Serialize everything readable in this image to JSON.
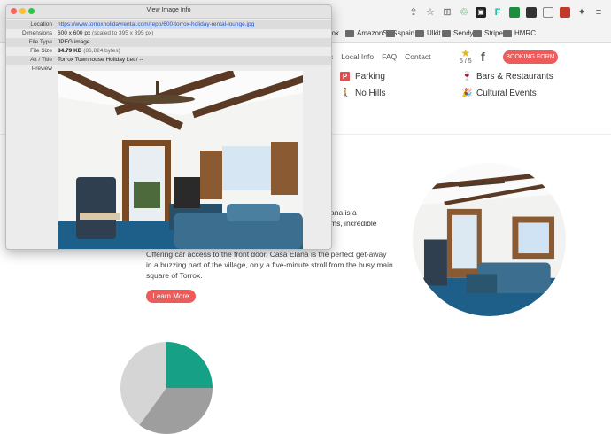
{
  "browser": {
    "bookmarks": [
      {
        "label": "ook",
        "folder": false
      },
      {
        "label": "AmazonSES",
        "folder": true
      },
      {
        "label": "spain",
        "folder": true
      },
      {
        "label": "Ulkit",
        "folder": true
      },
      {
        "label": "Sendy",
        "folder": true
      },
      {
        "label": "Stripe",
        "folder": true
      },
      {
        "label": "HMRC",
        "folder": true
      }
    ]
  },
  "site": {
    "nav": [
      "s",
      "Local Info",
      "FAQ",
      "Contact"
    ],
    "rating": "5 / 5",
    "booking_button": "BOOKING FORM",
    "amenities": [
      {
        "label": "Parking",
        "icon": "parking-icon"
      },
      {
        "label": "Bars & Restaurants",
        "icon": "glasses-icon"
      },
      {
        "label": "No Hills",
        "icon": "walk-icon"
      },
      {
        "label": "Cultural Events",
        "icon": "confetti-icon"
      }
    ],
    "fragment1": "ana is a",
    "fragment2": "ms, incredible",
    "body_text": "Offering car access to the front door, Casa Elana is the perfect get-away in a buzzing part of the village, only a five-minute stroll from the busy main square of Torrox.",
    "learn_more": "Learn More"
  },
  "image_info": {
    "title": "View Image Info",
    "rows": [
      {
        "label": "Location",
        "value": "https://www.torroxholidayrental.com/repo/600-torrox-holiday-rental-lounge.jpg",
        "note": ""
      },
      {
        "label": "Dimensions",
        "value": "600 x 600 px",
        "note": "(scaled to 395 x 395 px)"
      },
      {
        "label": "File Type",
        "value": "JPEG image",
        "note": ""
      },
      {
        "label": "File Size",
        "value": "84.79 KB",
        "note": "(86,824 bytes)"
      },
      {
        "label": "Alt / Title",
        "value": "Torrox Townhouse Holiday Let / --",
        "note": ""
      },
      {
        "label": "Preview",
        "value": "",
        "note": ""
      }
    ]
  },
  "colors": {
    "accent": "#ee5b5b",
    "star": "#e7b416"
  }
}
